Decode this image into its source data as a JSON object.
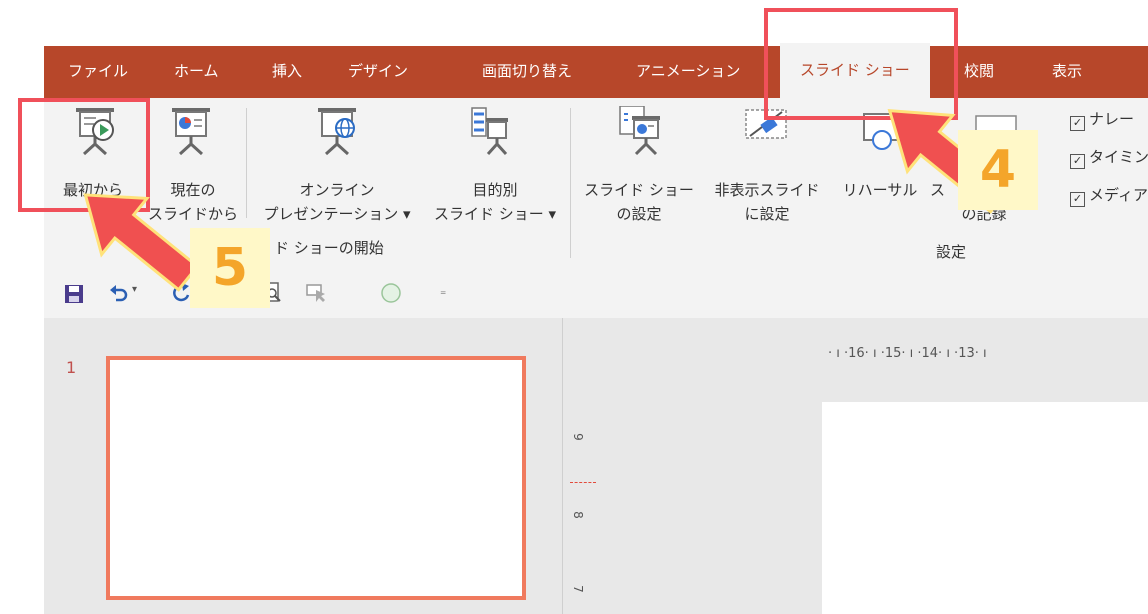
{
  "tabs": [
    "ファイル",
    "ホーム",
    "挿入",
    "デザイン",
    "画面切り替え",
    "アニメーション",
    "スライド ショー",
    "校閲",
    "表示"
  ],
  "active_tab": "スライド ショー",
  "ribbon": {
    "from_start": "最初から",
    "from_current": [
      "現在の",
      "スライドから"
    ],
    "online": [
      "オンライン",
      "プレゼンテーション ▾"
    ],
    "custom": [
      "目的別",
      "スライド ショー ▾"
    ],
    "setup": [
      "スライド ショー",
      "の設定"
    ],
    "hide": [
      "非表示スライド",
      "に設定"
    ],
    "rehearse": "リハーサル",
    "record_partial": [
      "ス",
      "ー",
      "の記録"
    ],
    "group_start": "ド ショーの開始",
    "group_setup": "設定",
    "checkboxes": [
      "ナレー",
      "タイミン",
      "メディア"
    ]
  },
  "slide_number": "1",
  "ruler_h": "· ı ·16· ı ·15· ı ·14· ı ·13· ı",
  "ruler_v": [
    "9",
    "8",
    "7"
  ],
  "badges": {
    "four": "4",
    "five": "5"
  },
  "colors": {
    "tab_bar": "#b7472a",
    "highlight": "#f0505a",
    "arrow": "#f05050",
    "badge_text": "#f4a52a",
    "badge_bg": "#fff8c8"
  }
}
